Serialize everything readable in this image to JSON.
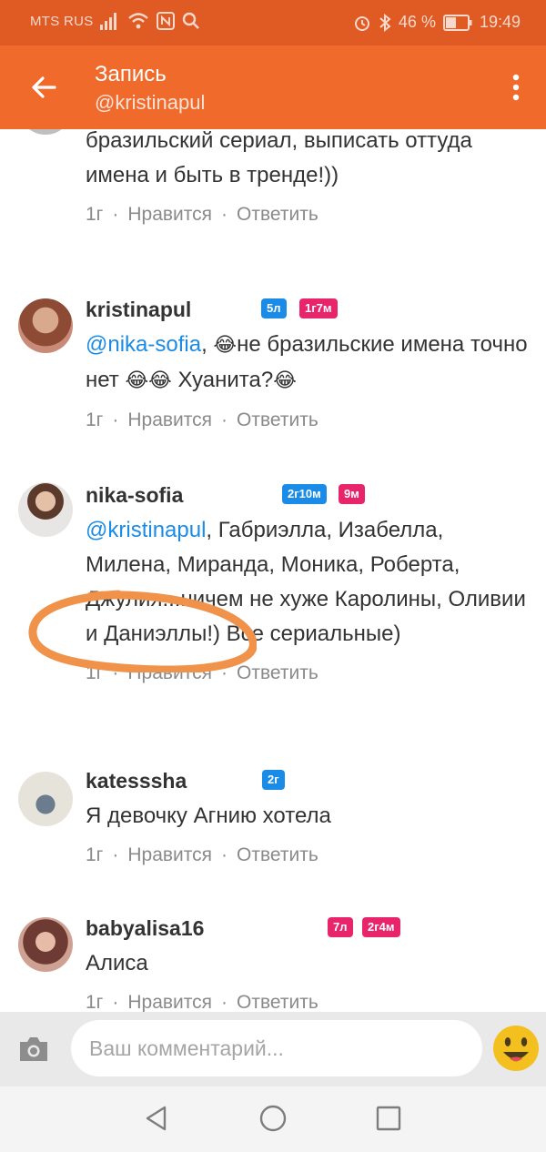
{
  "status_bar": {
    "carrier": "MTS RUS",
    "battery_percent": "46 %",
    "time": "19:49"
  },
  "header": {
    "title": "Запись",
    "subtitle": "@kristinapul"
  },
  "comments": [
    {
      "author": "",
      "text": "А вообще можно включить любой бразильский сериал, выписать оттуда имена и быть в тренде!))",
      "time": "1г",
      "like": "Нравится",
      "reply": "Ответить"
    },
    {
      "author": "kristinapul",
      "badges": [
        "5л",
        "1г7м"
      ],
      "mention": "@nika-sofia",
      "text_parts": [
        ", ",
        "не бразильские имена точно нет ",
        " Хуанита?"
      ],
      "time": "1г",
      "like": "Нравится",
      "reply": "Ответить"
    },
    {
      "author": "nika-sofia",
      "badges": [
        "2г10м",
        "9м"
      ],
      "mention": "@kristinapul",
      "text": ", Габриэлла, Изабелла, Милена, Миранда, Моника, Роберта, Джулия...ничем не хуже Каролины, Оливии и Даниэллы!) Все сериальные)",
      "time": "1г",
      "like": "Нравится",
      "reply": "Ответить"
    },
    {
      "author": "katesssha",
      "badges": [
        "2г"
      ],
      "text": "Я девочку Агнию хотела",
      "time": "1г",
      "like": "Нравится",
      "reply": "Ответить"
    },
    {
      "author": "babyalisa16",
      "badges": [
        "7л",
        "2г4м"
      ],
      "text": "Алиса",
      "time": "1г",
      "like": "Нравится",
      "reply": "Ответить"
    }
  ],
  "composer": {
    "placeholder": "Ваш комментарий..."
  },
  "icons": {
    "back": "arrow-left-icon",
    "menu": "more-vert-icon",
    "camera": "camera-icon",
    "emoji": "smiley-icon",
    "nav_back": "triangle-back-icon",
    "nav_home": "circle-home-icon",
    "nav_recent": "square-recent-icon"
  },
  "colors": {
    "status_bar": "#e05a24",
    "app_bar": "#f06a2c",
    "badge_blue": "#1a8be6",
    "badge_pink": "#e8246a",
    "annotation": "#f0924a"
  }
}
